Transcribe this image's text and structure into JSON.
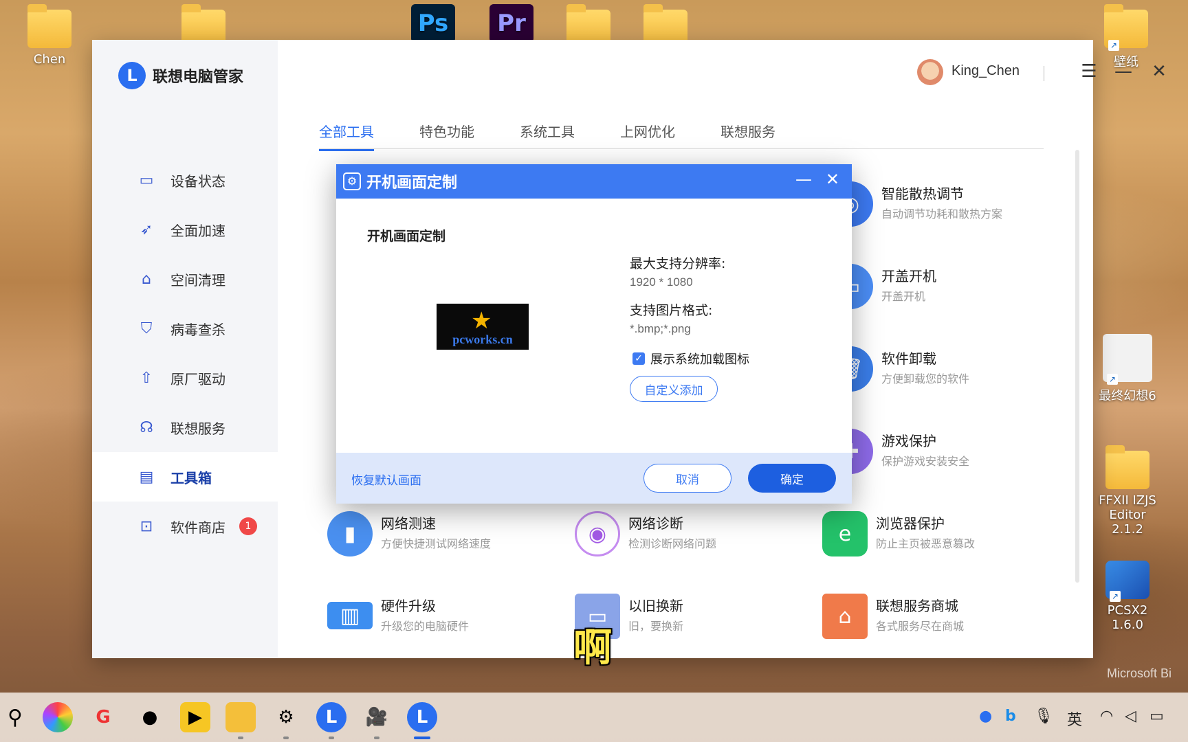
{
  "desktop": {
    "icons": [
      {
        "label": "Chen"
      },
      {
        "label": "壁纸"
      },
      {
        "label": "最终幻想6"
      },
      {
        "label": "FFXII IZJS Editor 2.1.2"
      },
      {
        "label": "PCSX2 1.6.0"
      }
    ],
    "watermark": "Microsoft Bi"
  },
  "app": {
    "brand": "联想电脑管家",
    "brand_logo": "L",
    "user": {
      "name": "King_Chen"
    },
    "nav": [
      {
        "label": "设备状态",
        "icon": "monitor-icon"
      },
      {
        "label": "全面加速",
        "icon": "rocket-icon"
      },
      {
        "label": "空间清理",
        "icon": "broom-icon"
      },
      {
        "label": "病毒查杀",
        "icon": "shield-icon"
      },
      {
        "label": "原厂驱动",
        "icon": "driver-icon"
      },
      {
        "label": "联想服务",
        "icon": "headset-icon"
      },
      {
        "label": "工具箱",
        "icon": "toolbox-icon",
        "active": true
      },
      {
        "label": "软件商店",
        "icon": "store-icon",
        "badge": "1"
      }
    ],
    "tabs": [
      "全部工具",
      "特色功能",
      "系统工具",
      "上网优化",
      "联想服务"
    ],
    "tools": [
      {
        "name": "智能散热调节",
        "desc": "自动调节功耗和散热方案"
      },
      {
        "name": "开盖开机",
        "desc": "开盖开机"
      },
      {
        "name": "软件卸载",
        "desc": "方便卸载您的软件"
      },
      {
        "name": "游戏保护",
        "desc": "保护游戏安装安全"
      },
      {
        "name": "网络测速",
        "desc": "方便快捷测试网络速度"
      },
      {
        "name": "网络诊断",
        "desc": "检测诊断网络问题"
      },
      {
        "name": "浏览器保护",
        "desc": "防止主页被恶意篡改"
      },
      {
        "name": "硬件升级",
        "desc": "升级您的电脑硬件"
      },
      {
        "name": "以旧换新",
        "desc": "旧，要换新"
      },
      {
        "name": "联想服务商城",
        "desc": "各式服务尽在商城"
      }
    ]
  },
  "dialog": {
    "title": "开机画面定制",
    "subtitle": "开机画面定制",
    "preview_label": "pcworks.cn",
    "max_res_label": "最大支持分辨率:",
    "max_res_value": "1920 * 1080",
    "format_label": "支持图片格式:",
    "format_value": "*.bmp;*.png",
    "show_icon_label": "展示系统加载图标",
    "show_icon_checked": true,
    "custom_add": "自定义添加",
    "restore_default": "恢复默认画面",
    "cancel": "取消",
    "ok": "确定"
  },
  "caption": "啊",
  "taskbar": {
    "tray_ime": "英"
  },
  "colors": {
    "accent": "#2a6ef0",
    "dialog_header": "#3d7af2",
    "badge": "#f04848"
  }
}
